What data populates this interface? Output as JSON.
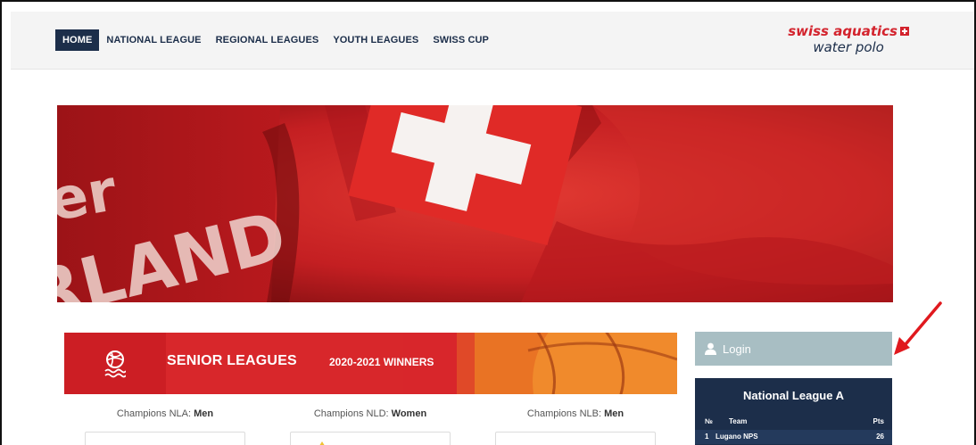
{
  "nav": {
    "items": [
      "HOME",
      "NATIONAL LEAGUE",
      "REGIONAL LEAGUES",
      "YOUTH LEAGUES",
      "SWISS CUP"
    ],
    "active_index": 0
  },
  "brand": {
    "line1": "swiss aquatics",
    "line2": "water polo",
    "flag_icon": "swiss-flag-icon"
  },
  "hero": {
    "image": "red swiss-flag towel photo",
    "text_fragments": [
      "er",
      "RLAND"
    ]
  },
  "senior": {
    "title": "SENIOR LEAGUES",
    "subtitle": "2020-2021 WINNERS",
    "icon": "water-polo-ball-icon"
  },
  "champions": [
    {
      "label": "Champions NLA: ",
      "gender": "Men"
    },
    {
      "label": "Champions NLD: ",
      "gender": "Women"
    },
    {
      "label": "Champions NLB: ",
      "gender": "Men"
    }
  ],
  "login": {
    "label": "Login",
    "icon": "user-icon"
  },
  "nla": {
    "title": "National League A",
    "headers": {
      "no": "№",
      "team": "Team",
      "pts": "Pts"
    },
    "rows": [
      {
        "no": "1",
        "team": "Lugano NPS",
        "pts": "26"
      }
    ]
  },
  "colors": {
    "navy": "#1c2e4a",
    "red": "#d3232d",
    "login_bg": "#a8bec3",
    "annotation_arrow": "#e0191e"
  }
}
